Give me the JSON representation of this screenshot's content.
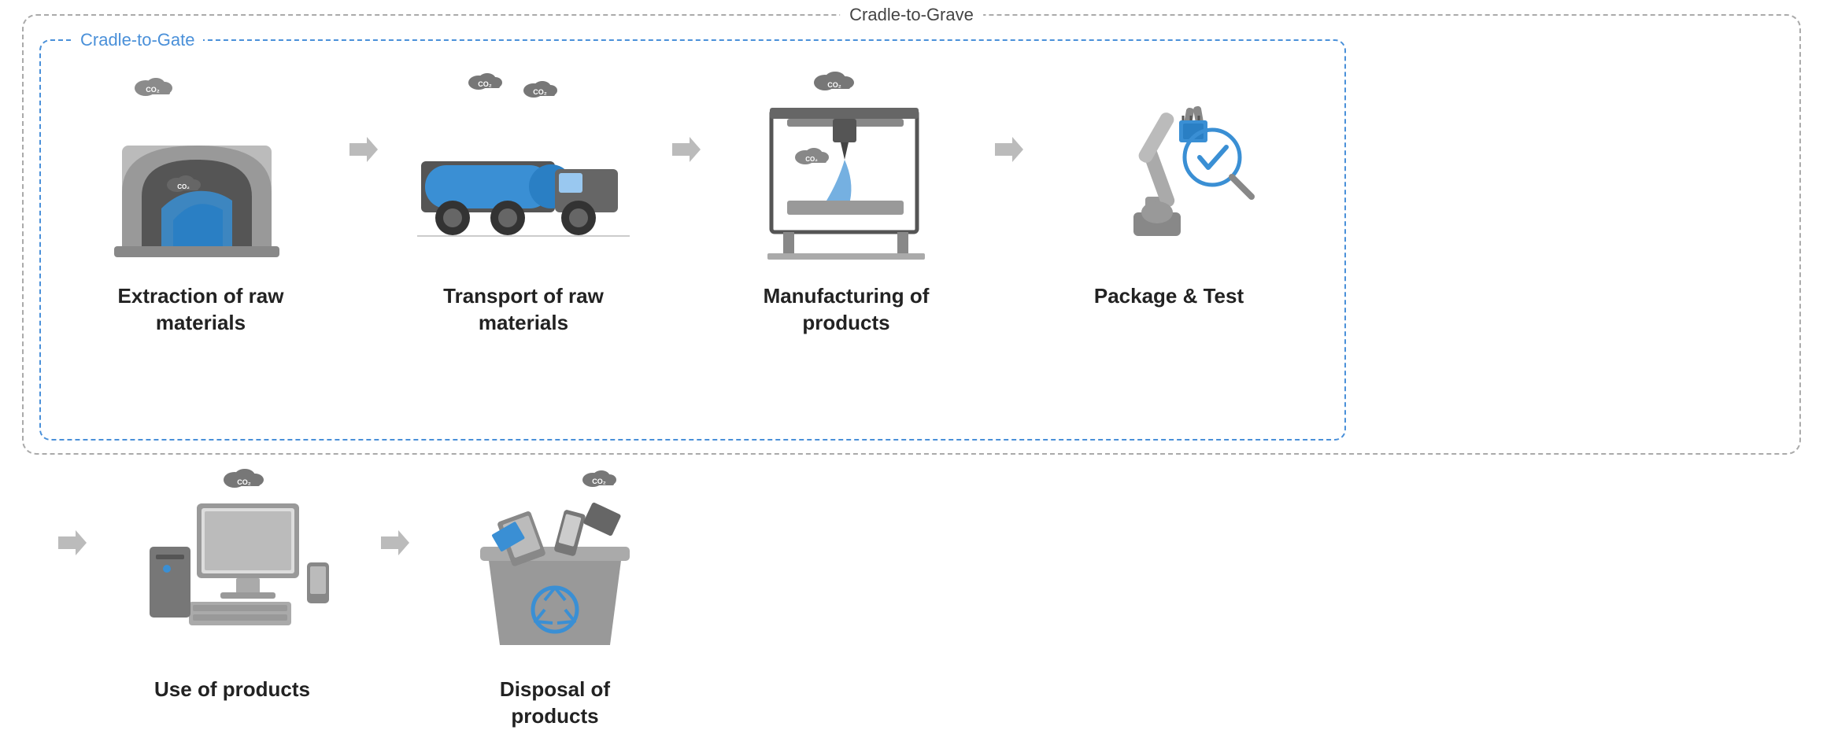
{
  "labels": {
    "cradleToGrave": "Cradle-to-Grave",
    "cradleToGate": "Cradle-to-Gate"
  },
  "stages": [
    {
      "id": "extraction",
      "label": "Extraction of raw\nmaterials",
      "inside": true
    },
    {
      "id": "transport",
      "label": "Transport of raw\nmaterials",
      "inside": true
    },
    {
      "id": "manufacturing",
      "label": "Manufacturing of\nproducts",
      "inside": true
    },
    {
      "id": "package",
      "label": "Package & Test",
      "inside": true
    },
    {
      "id": "use",
      "label": "Use of products",
      "inside": false
    },
    {
      "id": "disposal",
      "label": "Disposal of\nproducts",
      "inside": false
    }
  ],
  "colors": {
    "blue": "#3a8fd4",
    "grayDark": "#555",
    "grayMed": "#888",
    "grayLight": "#ccc",
    "borderBlue": "#4a90d9",
    "black": "#222"
  }
}
